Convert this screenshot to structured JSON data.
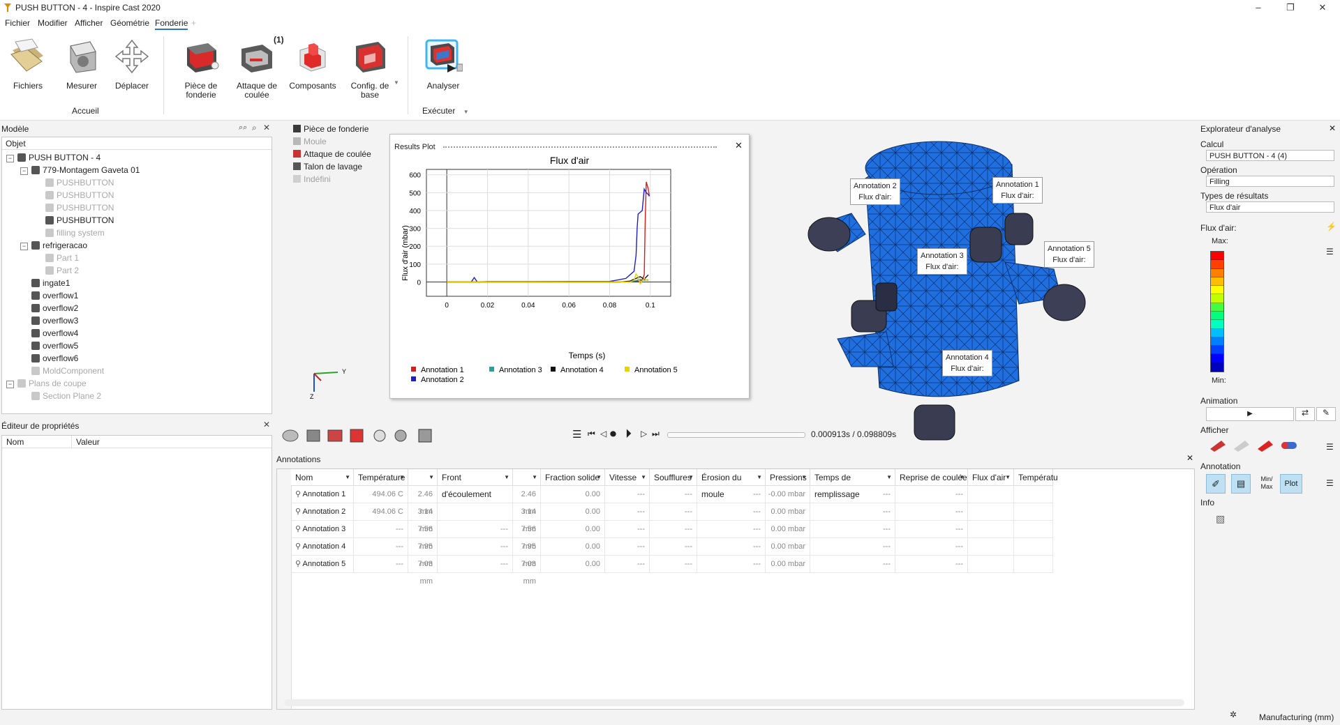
{
  "window": {
    "title": "PUSH BUTTON - 4 - Inspire Cast 2020",
    "minimize": "–",
    "maximize": "❐",
    "close": "✕"
  },
  "menu": {
    "items": [
      "Fichier",
      "Modifier",
      "Afficher",
      "Géométrie",
      "Fonderie"
    ],
    "active": "Fonderie",
    "add": "+"
  },
  "ribbon": {
    "buttons": [
      {
        "label": "Fichiers",
        "icon": "files-icon"
      },
      {
        "label": "Mesurer",
        "icon": "measure-icon"
      },
      {
        "label": "Déplacer",
        "icon": "move-icon"
      },
      {
        "label": "Pièce de fonderie",
        "icon": "casting-part-icon"
      },
      {
        "label": "Attaque de coulée",
        "icon": "gating-icon"
      },
      {
        "label": "Composants",
        "icon": "components-icon"
      },
      {
        "label": "Config. de base",
        "icon": "base-config-icon"
      },
      {
        "label": "Analyser",
        "icon": "analyze-icon"
      }
    ],
    "badge": "(1)",
    "group_home": "Accueil",
    "group_run": "Exécuter",
    "group_run_arrow": "▼"
  },
  "model_panel": {
    "title": "Modèle",
    "column": "Objet",
    "close": "✕",
    "tree": [
      {
        "label": "PUSH BUTTON - 4",
        "level": 0,
        "expander": "⊟",
        "dim": false
      },
      {
        "label": "779-Montagem Gaveta 01",
        "level": 1,
        "expander": "⊟",
        "dim": false
      },
      {
        "label": "PUSHBUTTON",
        "level": 2,
        "expander": "",
        "dim": true
      },
      {
        "label": "PUSHBUTTON",
        "level": 2,
        "expander": "",
        "dim": true
      },
      {
        "label": "PUSHBUTTON",
        "level": 2,
        "expander": "",
        "dim": true
      },
      {
        "label": "PUSHBUTTON",
        "level": 2,
        "expander": "",
        "dim": false
      },
      {
        "label": "filling system",
        "level": 2,
        "expander": "",
        "dim": true
      },
      {
        "label": "refrigeracao",
        "level": 1,
        "expander": "⊟",
        "dim": false
      },
      {
        "label": "Part 1",
        "level": 2,
        "expander": "",
        "dim": true
      },
      {
        "label": "Part 2",
        "level": 2,
        "expander": "",
        "dim": true
      },
      {
        "label": "ingate1",
        "level": 1,
        "expander": "",
        "dim": false
      },
      {
        "label": "overflow1",
        "level": 1,
        "expander": "",
        "dim": false
      },
      {
        "label": "overflow2",
        "level": 1,
        "expander": "",
        "dim": false
      },
      {
        "label": "overflow3",
        "level": 1,
        "expander": "",
        "dim": false
      },
      {
        "label": "overflow4",
        "level": 1,
        "expander": "",
        "dim": false
      },
      {
        "label": "overflow5",
        "level": 1,
        "expander": "",
        "dim": false
      },
      {
        "label": "overflow6",
        "level": 1,
        "expander": "",
        "dim": false
      },
      {
        "label": "MoldComponent",
        "level": 1,
        "expander": "",
        "dim": true
      },
      {
        "label": "Plans de coupe",
        "level": 0,
        "expander": "⊟",
        "dim": true
      },
      {
        "label": "Section Plane 2",
        "level": 1,
        "expander": "",
        "dim": true
      }
    ]
  },
  "properties_panel": {
    "title": "Éditeur de propriétés",
    "col_name": "Nom",
    "col_value": "Valeur",
    "close": "✕"
  },
  "legend": [
    {
      "label": "Pièce de fonderie",
      "color": "#3a3a3a",
      "dim": false
    },
    {
      "label": "Moule",
      "color": "#b8b8b8",
      "dim": true
    },
    {
      "label": "Attaque de coulée",
      "color": "#c83232",
      "dim": false
    },
    {
      "label": "Talon de lavage",
      "color": "#555555",
      "dim": false
    },
    {
      "label": "Indéfini",
      "color": "#cfcfcf",
      "dim": true
    }
  ],
  "results_plot": {
    "window_title": "Results Plot",
    "close": "✕"
  },
  "chart_data": {
    "type": "line",
    "title": "Flux d'air",
    "xlabel": "Temps (s)",
    "ylabel": "Flux d'air (mbar)",
    "xlim": [
      -0.01,
      0.11
    ],
    "ylim": [
      -80,
      630
    ],
    "xticks": [
      0,
      0.02,
      0.04,
      0.06,
      0.08,
      0.1
    ],
    "xticklabels": [
      "0",
      "0.02",
      "0.04",
      "0.06",
      "0.08",
      "0.1"
    ],
    "yticks": [
      0,
      100,
      200,
      300,
      400,
      500,
      600
    ],
    "grid": true,
    "legend_position": "bottom",
    "series": [
      {
        "name": "Annotation 1",
        "color": "#d81b1b",
        "x": [
          0,
          0.085,
          0.094,
          0.096,
          0.097,
          0.0975,
          0.098,
          0.099,
          0.0995
        ],
        "y": [
          0,
          0,
          5,
          10,
          40,
          350,
          560,
          520,
          480
        ]
      },
      {
        "name": "Annotation 2",
        "color": "#1e1ec8",
        "x": [
          0,
          0.012,
          0.0135,
          0.015,
          0.02,
          0.08,
          0.088,
          0.09,
          0.092,
          0.093,
          0.0935,
          0.094,
          0.095,
          0.096,
          0.097,
          0.098,
          0.099,
          0.0995
        ],
        "y": [
          0,
          0,
          25,
          0,
          2,
          3,
          20,
          40,
          60,
          150,
          300,
          380,
          390,
          400,
          520,
          500,
          490,
          480
        ]
      },
      {
        "name": "Annotation 3",
        "color": "#2aa198",
        "x": [
          0,
          0.09,
          0.093,
          0.095,
          0.097,
          0.099
        ],
        "y": [
          0,
          0,
          8,
          15,
          10,
          12
        ]
      },
      {
        "name": "Annotation 4",
        "color": "#111111",
        "x": [
          0,
          0.085,
          0.09,
          0.093,
          0.095,
          0.097,
          0.099
        ],
        "y": [
          0,
          0,
          5,
          20,
          30,
          15,
          40
        ]
      },
      {
        "name": "Annotation 5",
        "color": "#e8d200",
        "x": [
          0,
          0.09,
          0.092,
          0.093,
          0.094,
          0.095,
          0.097,
          0.099
        ],
        "y": [
          0,
          0,
          10,
          45,
          30,
          -10,
          20,
          5
        ]
      }
    ]
  },
  "viewport": {
    "callouts": [
      {
        "name": "Annotation 2",
        "sub": "Flux d'air:"
      },
      {
        "name": "Annotation 1",
        "sub": "Flux d'air:"
      },
      {
        "name": "Annotation 3",
        "sub": "Flux d'air:"
      },
      {
        "name": "Annotation 5",
        "sub": "Flux d'air:"
      },
      {
        "name": "Annotation 4",
        "sub": "Flux d'air:"
      }
    ],
    "time_readout": "0.000913s / 0.098809s",
    "axis_y": "Y",
    "axis_z": "Z"
  },
  "annotations_table": {
    "title": "Annotations",
    "close": "✕",
    "columns": [
      "Nom",
      "Température",
      "",
      "Front d'écoulement",
      "",
      "Fraction solide",
      "Vitesse",
      "Soufflures",
      "Érosion du moule",
      "Pressions",
      "Temps de remplissage",
      "Reprise de coulée",
      "Flux d'air",
      "Températu"
    ],
    "rows": [
      [
        "Annotation 1",
        "494.06 C",
        "2.46 mm",
        "",
        "2.46 mm",
        "0.00",
        "---",
        "---",
        "---",
        "-0.00 mbar",
        "---",
        "---",
        "",
        ""
      ],
      [
        "Annotation 2",
        "494.06 C",
        "3.14 mm",
        "",
        "3.14 mm",
        "0.00",
        "---",
        "---",
        "---",
        "0.00 mbar",
        "---",
        "---",
        "",
        ""
      ],
      [
        "Annotation 3",
        "---",
        "7.56 mm",
        "---",
        "7.56 mm",
        "0.00",
        "---",
        "---",
        "---",
        "0.00 mbar",
        "---",
        "---",
        "",
        ""
      ],
      [
        "Annotation 4",
        "---",
        "7.95 mm",
        "---",
        "7.95 mm",
        "0.00",
        "---",
        "---",
        "---",
        "0.00 mbar",
        "---",
        "---",
        "",
        ""
      ],
      [
        "Annotation 5",
        "---",
        "7.03 mm",
        "---",
        "7.03 mm",
        "0.00",
        "---",
        "---",
        "---",
        "0.00 mbar",
        "---",
        "---",
        "",
        ""
      ]
    ]
  },
  "right_panel": {
    "title": "Explorateur d'analyse",
    "close": "✕",
    "calcul_label": "Calcul",
    "calcul_value": "PUSH BUTTON - 4 (4)",
    "operation_label": "Opération",
    "operation_value": "Filling",
    "types_label": "Types de résultats",
    "types_value": "Flux d'air",
    "scale_label": "Flux d'air:",
    "max_label": "Max:",
    "min_label": "Min:",
    "animation_label": "Animation",
    "play": "▶",
    "afficher_label": "Afficher",
    "annotation_label": "Annotation",
    "minmax_label": "Min/\nMax",
    "plot_label": "Plot",
    "info_label": "Info",
    "colors": [
      "#ff0000",
      "#ff4000",
      "#ff8000",
      "#ffbf00",
      "#ffff00",
      "#bfff00",
      "#40ff40",
      "#00ff80",
      "#00ffbf",
      "#00bfff",
      "#0080ff",
      "#0040ff",
      "#0000ff",
      "#0000c0"
    ]
  },
  "status": {
    "units": "Manufacturing (mm)"
  }
}
